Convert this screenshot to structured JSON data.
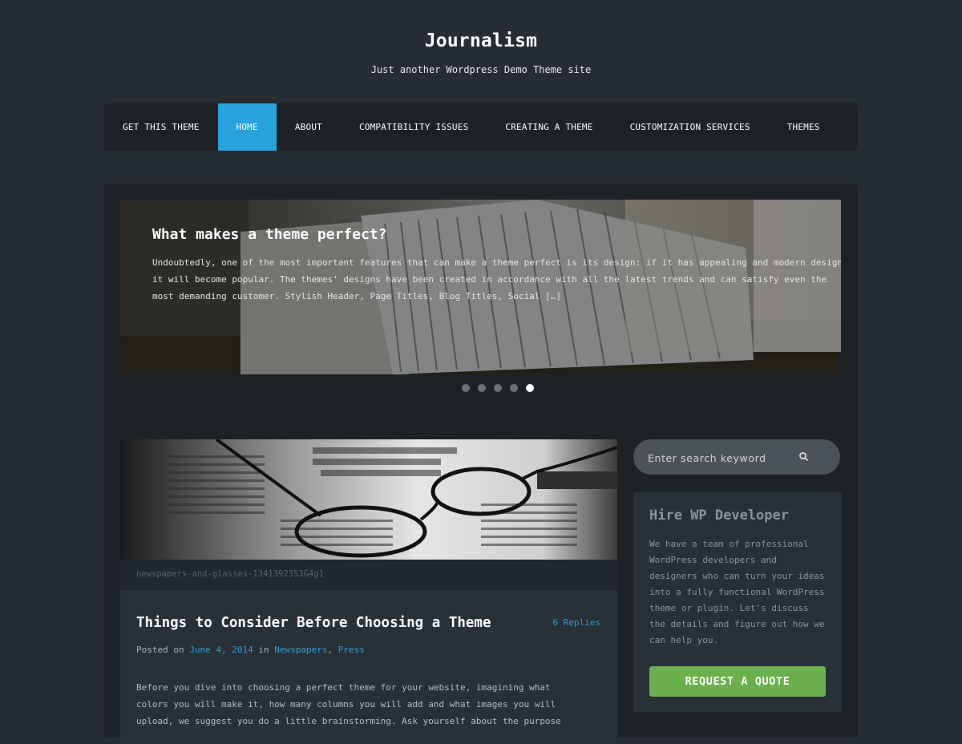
{
  "site": {
    "title": "Journalism",
    "tagline": "Just another Wordpress Demo Theme site"
  },
  "nav": {
    "items": [
      {
        "label": "GET THIS THEME",
        "active": false
      },
      {
        "label": "HOME",
        "active": true
      },
      {
        "label": "ABOUT",
        "active": false
      },
      {
        "label": "COMPATIBILITY ISSUES",
        "active": false
      },
      {
        "label": "CREATING A THEME",
        "active": false
      },
      {
        "label": "CUSTOMIZATION SERVICES",
        "active": false
      },
      {
        "label": "THEMES",
        "active": false
      }
    ]
  },
  "slider": {
    "title": "What makes a theme perfect?",
    "excerpt": "Undoubtedly, one of the most important features that can make a theme perfect is its design: if it has appealing and modern design, it will become popular. The themes' designs have been created in accordance with all the latest trends and can satisfy even the most demanding customer. Stylish Header, Page Titles, Blog Titles, Social […]",
    "dot_count": 5,
    "active_dot": 5
  },
  "post": {
    "image_caption": "newspapers-and-glasses-1341392353G4g1",
    "title": "Things to Consider Before Choosing a Theme",
    "replies": "6 Replies",
    "meta": {
      "posted_on": "Posted on",
      "date": "June 4, 2014",
      "in": "in",
      "category1": "Newspapers",
      "separator": ",",
      "category2": "Press"
    },
    "body": "Before you dive into choosing a perfect theme for your website, imagining what colors you will make it, how many columns you will add and what images you will upload, we suggest you do a little brainstorming. Ask yourself about the purpose"
  },
  "search": {
    "placeholder": "Enter search keyword",
    "icon": "search-icon"
  },
  "widget": {
    "title": "Hire WP Developer",
    "text": "We have a team of professional WordPress developers and designers who can turn your ideas into a fully functional WordPress theme or plugin. Let's discuss the details and figure out how we can help you.",
    "button_label": "REQUEST A QUOTE"
  },
  "colors": {
    "background": "#262d34",
    "panel": "#1d2226",
    "accent": "#27a2db",
    "button_green": "#6ab04c"
  }
}
